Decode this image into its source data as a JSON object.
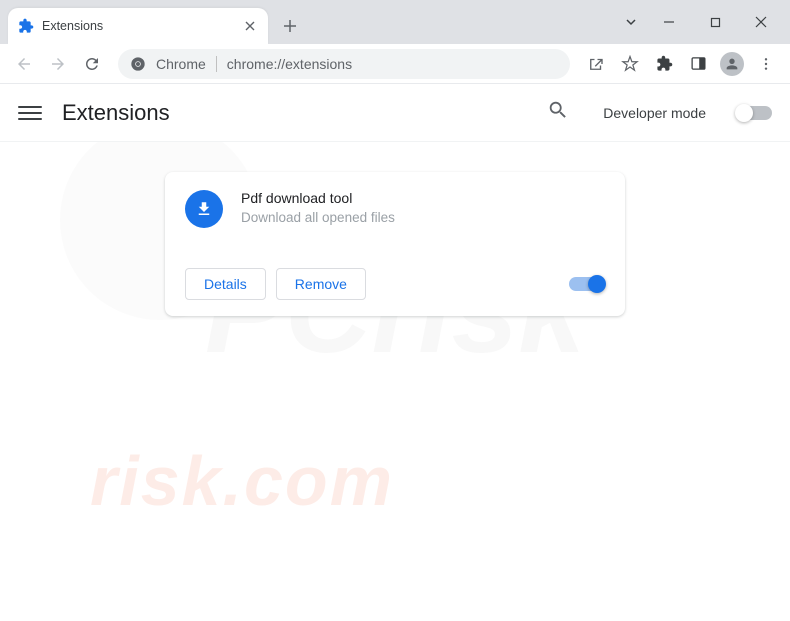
{
  "window": {
    "tab_title": "Extensions"
  },
  "omnibox": {
    "protocol_label": "Chrome",
    "url": "chrome://extensions"
  },
  "page": {
    "title": "Extensions",
    "dev_mode_label": "Developer mode",
    "dev_mode_on": false
  },
  "extension": {
    "name": "Pdf download tool",
    "description": "Download all opened files",
    "details_label": "Details",
    "remove_label": "Remove",
    "enabled": true
  }
}
